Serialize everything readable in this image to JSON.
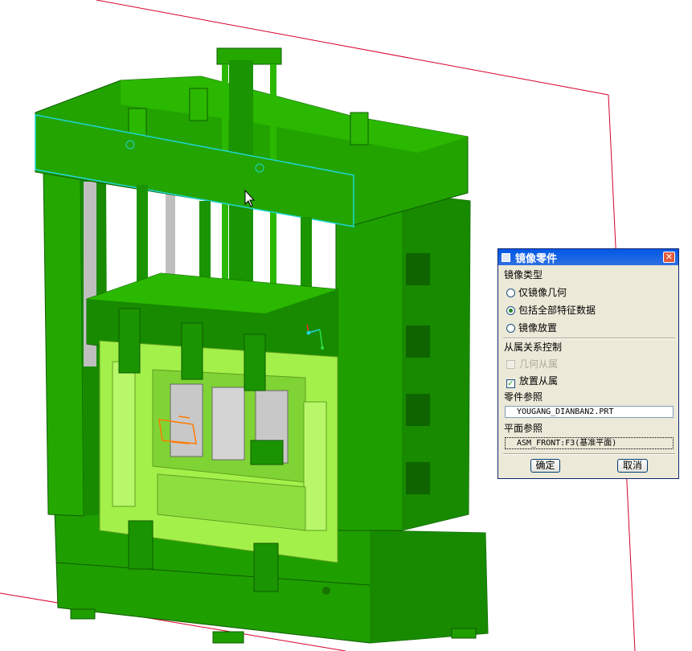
{
  "dialog": {
    "title": "镜像零件",
    "close_symbol": "✕",
    "mirror_type_label": "镜像类型",
    "options": {
      "geometry_only": "仅镜像几何",
      "all_features": "包括全部特征数据",
      "placement": "镜像放置"
    },
    "selected_option": "all_features",
    "dependency_label": "从属关系控制",
    "geometry_dependent": "几何从属",
    "placement_dependent": "放置从属",
    "part_ref_label": "零件参照",
    "part_ref_value": "YOUGANG_DIANBAN2.PRT",
    "plane_ref_label": "平面参照",
    "plane_ref_value": "ASM_FRONT:F3(基准平面)",
    "ok": "确定",
    "cancel": "取消"
  },
  "icons": {
    "window": "window-icon",
    "close": "close-icon",
    "cursor": "cursor-arrow-icon",
    "csys": "coordinate-system-icon"
  },
  "colors": {
    "frame_green": "#1f9e00",
    "frame_dark": "#157300",
    "part_light": "#a3f04a",
    "part_mid": "#7fd334",
    "highlight_cyan": "#1fd6d6",
    "datum_red": "#d6002a",
    "selection_orange": "#ff7a00"
  }
}
